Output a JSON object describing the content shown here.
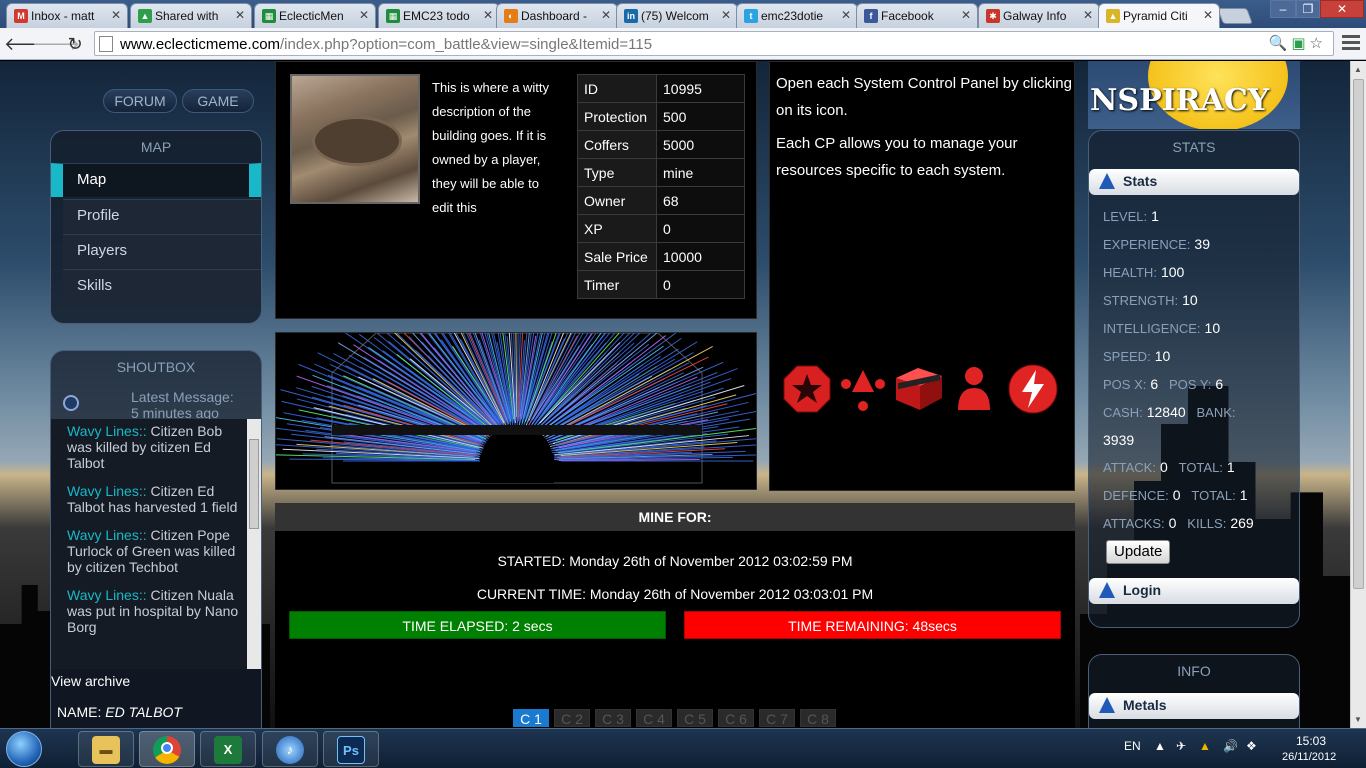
{
  "browser": {
    "tabs": [
      {
        "title": "Inbox - matt",
        "icon_color": "#d23a2f",
        "icon_glyph": "M"
      },
      {
        "title": "Shared with",
        "icon_color": "#2e9e4a",
        "icon_glyph": "▲"
      },
      {
        "title": "EclecticMen",
        "icon_color": "#1f8d3c",
        "icon_glyph": "▦"
      },
      {
        "title": "EMC23 todo",
        "icon_color": "#1f8d3c",
        "icon_glyph": "▦"
      },
      {
        "title": "Dashboard -",
        "icon_color": "#e57c16",
        "icon_glyph": "◐"
      },
      {
        "title": "(75) Welcom",
        "icon_color": "#1a6aaa",
        "icon_glyph": "in"
      },
      {
        "title": "emc23dotie",
        "icon_color": "#2aa3e0",
        "icon_glyph": "t"
      },
      {
        "title": "Facebook",
        "icon_color": "#3b5998",
        "icon_glyph": "f"
      },
      {
        "title": "Galway Info",
        "icon_color": "#c7382b",
        "icon_glyph": "✱"
      },
      {
        "title": "Pyramid Citi",
        "icon_color": "#d9b52a",
        "icon_glyph": "▲"
      }
    ],
    "url_host": "www.eclecticmeme.com",
    "url_path": "/index.php?option=com_battle&view=single&Itemid=115"
  },
  "nav": {
    "forum": "FORUM",
    "game": "GAME"
  },
  "map_panel": {
    "title": "MAP",
    "items": [
      "Map",
      "Profile",
      "Players",
      "Skills"
    ]
  },
  "shoutbox": {
    "title": "SHOUTBOX",
    "latest_label": "Latest Message:",
    "latest_ago": "5 minutes ago",
    "items": [
      {
        "who": "Wavy Lines::",
        "text": " Citizen Bob was killed by citizen Ed Talbot"
      },
      {
        "who": "Wavy Lines::",
        "text": " Citizen Ed Talbot has harvested 1 field"
      },
      {
        "who": "Wavy Lines::",
        "text": " Citizen Pope Turlock of Green was killed by citizen Techbot"
      },
      {
        "who": "Wavy Lines::",
        "text": " Citizen Nuala was put in hospital by Nano Borg"
      }
    ],
    "archive": "View archive",
    "name_label": "NAME:",
    "name_value": "ED TALBOT"
  },
  "building": {
    "description": "This is where a witty description of the building goes. If it is owned by a player, they will be able to edit this",
    "fields": [
      {
        "k": "ID",
        "v": "10995"
      },
      {
        "k": "Protection",
        "v": "500"
      },
      {
        "k": "Coffers",
        "v": "5000"
      },
      {
        "k": "Type",
        "v": "mine"
      },
      {
        "k": "Owner",
        "v": "68"
      },
      {
        "k": "XP",
        "v": "0"
      },
      {
        "k": "Sale Price",
        "v": "10000"
      },
      {
        "k": "Timer",
        "v": "0"
      }
    ]
  },
  "cp": {
    "line1": "Open each System Control Panel by clicking on its icon.",
    "line2": "Each CP allows you to manage your resources specific to each system."
  },
  "mine": {
    "title": "MINE FOR:",
    "started": "STARTED: Monday 26th of November 2012 03:02:59 PM",
    "current": "CURRENT TIME: Monday 26th of November 2012 03:03:01 PM",
    "elapsed": "TIME ELAPSED: 2 secs",
    "remaining": "TIME REMAINING: 48secs",
    "pages": [
      "C 1",
      "C 2",
      "C 3",
      "C 4",
      "C 5",
      "C 6",
      "C 7",
      "C 8"
    ]
  },
  "right": {
    "banner": "NSPIRACY",
    "stats_title": "STATS",
    "stats_sub": "Stats",
    "level_k": "LEVEL:",
    "level_v": "1",
    "exp_k": "EXPERIENCE:",
    "exp_v": "39",
    "health_k": "HEALTH:",
    "health_v": "100",
    "str_k": "STRENGTH:",
    "str_v": "10",
    "int_k": "INTELLIGENCE:",
    "int_v": "10",
    "spd_k": "SPEED:",
    "spd_v": "10",
    "posx_k": "POS X:",
    "posx_v": "6",
    "posy_k": "POS Y:",
    "posy_v": "6",
    "cash_k": "CASH:",
    "cash_v": "12840",
    "bank_k": "BANK:",
    "bank_v": "3939",
    "att_k": "ATTACK:",
    "att_v": "0",
    "att_total_k": "TOTAL:",
    "att_total_v": "1",
    "def_k": "DEFENCE:",
    "def_v": "0",
    "def_total_k": "TOTAL:",
    "def_total_v": "1",
    "attacks_k": "ATTACKS:",
    "attacks_v": "0",
    "kills_k": "KILLS:",
    "kills_v": "269",
    "update": "Update",
    "login": "Login",
    "info_title": "INFO",
    "metals": "Metals"
  },
  "taskbar": {
    "lang": "EN",
    "time": "15:03",
    "date": "26/11/2012",
    "apps": [
      "explorer-icon",
      "chrome-icon",
      "excel-icon",
      "itunes-icon",
      "photoshop-icon"
    ]
  },
  "colors": {
    "accent": "#18b8c8",
    "elapsed_bar": "#008000",
    "remaining_bar": "#ff0000",
    "page_active": "#1a7ad0"
  }
}
